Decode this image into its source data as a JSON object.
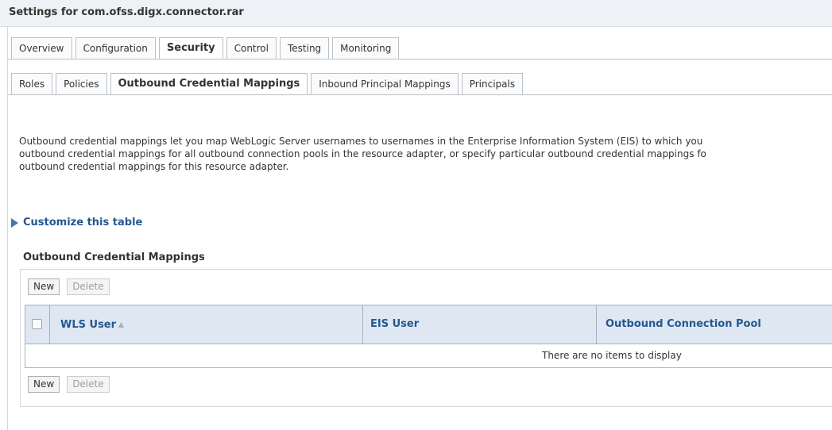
{
  "page": {
    "title": "Settings for com.ofss.digx.connector.rar"
  },
  "main_tabs": [
    {
      "label": "Overview"
    },
    {
      "label": "Configuration"
    },
    {
      "label": "Security",
      "active": true
    },
    {
      "label": "Control"
    },
    {
      "label": "Testing"
    },
    {
      "label": "Monitoring"
    }
  ],
  "sub_tabs": [
    {
      "label": "Roles"
    },
    {
      "label": "Policies"
    },
    {
      "label": "Outbound Credential Mappings",
      "active": true
    },
    {
      "label": "Inbound Principal Mappings"
    },
    {
      "label": "Principals"
    }
  ],
  "description": {
    "lines": [
      "Outbound credential mappings let you map WebLogic Server usernames to usernames in the Enterprise Information System (EIS) to which you",
      "outbound credential mappings for all outbound connection pools in the resource adapter, or specify particular outbound credential mappings fo",
      "outbound credential mappings for this resource adapter."
    ]
  },
  "customize": {
    "label": "Customize this table"
  },
  "table": {
    "title": "Outbound Credential Mappings",
    "buttons": {
      "new_label": "New",
      "delete_label": "Delete"
    },
    "columns": [
      {
        "label": "WLS User",
        "sort_icon": "sort-ascending-icon"
      },
      {
        "label": "EIS User"
      },
      {
        "label": "Outbound Connection Pool"
      }
    ],
    "empty_message": "There are no items to display"
  },
  "colors": {
    "link": "#245890",
    "header_bg": "#dfe7f2",
    "title_bar_bg": "#eef2f6"
  }
}
